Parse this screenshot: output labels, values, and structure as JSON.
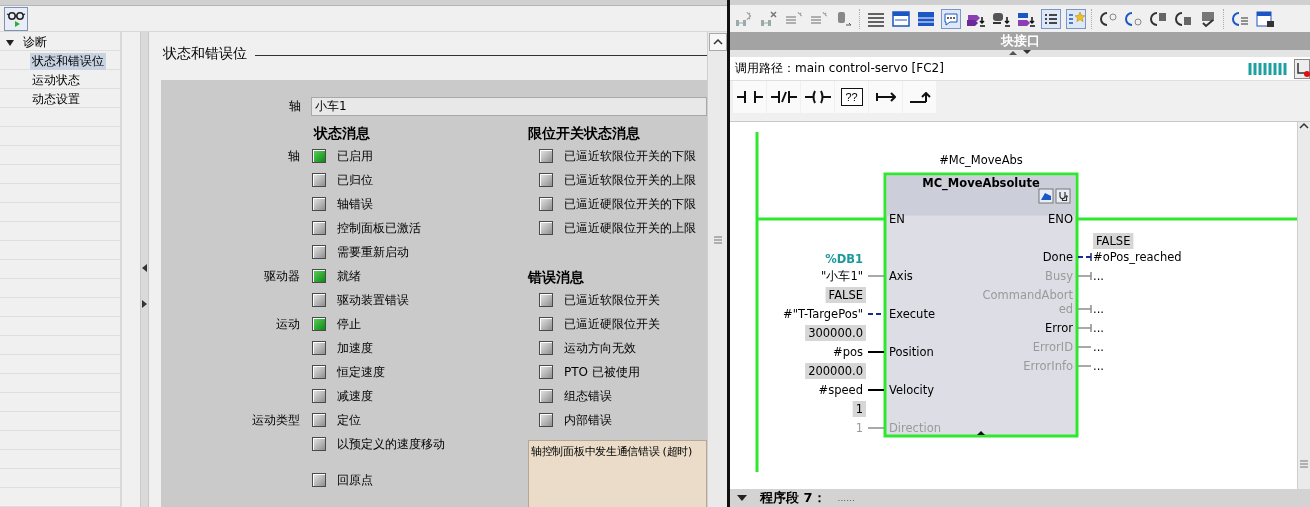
{
  "nav_tree": [
    {
      "label": "诊断",
      "expanded": true,
      "children": [
        {
          "label": "状态和错误位",
          "selected": true
        },
        {
          "label": "运动状态",
          "selected": false
        },
        {
          "label": "动态设置",
          "selected": false
        }
      ]
    }
  ],
  "section_title": "状态和错误位",
  "axis": {
    "label": "轴",
    "value": "小车1"
  },
  "status_messages": {
    "heading": "状态消息",
    "rows": [
      {
        "group": "轴",
        "label": "已启用",
        "on": true
      },
      {
        "label": "已归位",
        "on": false
      },
      {
        "label": "轴错误",
        "on": false
      },
      {
        "label": "控制面板已激活",
        "on": false
      },
      {
        "label": "需要重新启动",
        "on": false
      },
      {
        "group": "驱动器",
        "label": "就绪",
        "on": true
      },
      {
        "label": "驱动装置错误",
        "on": false
      },
      {
        "group": "运动",
        "label": "停止",
        "on": true
      },
      {
        "label": "加速度",
        "on": false
      },
      {
        "label": "恒定速度",
        "on": false
      },
      {
        "label": "减速度",
        "on": false
      },
      {
        "group": "运动类型",
        "label": "定位",
        "on": false
      },
      {
        "label": "以预定义的速度移动",
        "on": false
      }
    ]
  },
  "homing_messages": {
    "rows": [
      {
        "label": "回原点",
        "on": false
      }
    ]
  },
  "limit_switch_messages": {
    "heading": "限位开关状态消息",
    "rows": [
      {
        "label": "已逼近软限位开关的下限",
        "on": false
      },
      {
        "label": "已逼近软限位开关的上限",
        "on": false
      },
      {
        "label": "已逼近硬限位开关的下限",
        "on": false
      },
      {
        "label": "已逼近硬限位开关的上限",
        "on": false
      }
    ]
  },
  "error_messages": {
    "heading": "错误消息",
    "rows": [
      {
        "label": "已逼近软限位开关",
        "on": false
      },
      {
        "label": "已逼近硬限位开关",
        "on": false
      },
      {
        "label": "运动方向无效",
        "on": false
      },
      {
        "label": "PTO 已被使用",
        "on": false
      },
      {
        "label": "组态错误",
        "on": false
      },
      {
        "label": "内部错误",
        "on": false
      }
    ]
  },
  "error_text": "轴控制面板中发生通信错误 (超时)",
  "block_interface": {
    "title": "块接口"
  },
  "call_path": "调用路径：main control-servo [FC2]",
  "palette": [
    {
      "kind": "contact"
    },
    {
      "kind": "negated-contact"
    },
    {
      "kind": "coil"
    },
    {
      "kind": "empty-box",
      "label": "??"
    },
    {
      "kind": "open-branch"
    },
    {
      "kind": "close-branch"
    }
  ],
  "network": {
    "instance": "#Mc_MoveAbs",
    "block": "MC_MoveAbsolute",
    "inputs": [
      {
        "name": "EN",
        "active": true,
        "kind": "powered"
      },
      {
        "name": "Axis",
        "active": true,
        "kind": "grey",
        "address": "%DB1",
        "operand": "\"小车1\""
      },
      {
        "name": "Execute",
        "active": true,
        "kind": "dashed",
        "value": "FALSE",
        "operand": "#\"T-TargePos\""
      },
      {
        "name": "Position",
        "active": true,
        "kind": "solid",
        "value": "300000.0",
        "operand": "#pos"
      },
      {
        "name": "Velocity",
        "active": true,
        "kind": "solid",
        "value": "200000.0",
        "operand": "#speed"
      },
      {
        "name": "Direction",
        "active": false,
        "kind": "grey",
        "value": "1",
        "operand": "1"
      }
    ],
    "outputs": [
      {
        "name_lines": [
          "ENO"
        ],
        "active": true,
        "kind": "powered"
      },
      {
        "name_lines": [
          "Done"
        ],
        "active": true,
        "kind": "dashed",
        "value": "FALSE",
        "operand": "#oPos_reached"
      },
      {
        "name_lines": [
          "Busy"
        ],
        "active": false,
        "kind": "grey",
        "operand": "..."
      },
      {
        "name_lines": [
          "CommandAbort",
          "ed"
        ],
        "active": false,
        "kind": "grey",
        "operand": "..."
      },
      {
        "name_lines": [
          "Error"
        ],
        "active": true,
        "kind": "grey",
        "operand": "..."
      },
      {
        "name_lines": [
          "ErrorID"
        ],
        "active": false,
        "kind": "grey-plain",
        "operand": "..."
      },
      {
        "name_lines": [
          "ErrorInfo"
        ],
        "active": false,
        "kind": "grey-plain",
        "operand": "..."
      }
    ]
  },
  "next_network": {
    "title": "程序段 7：",
    "comment": "......"
  }
}
